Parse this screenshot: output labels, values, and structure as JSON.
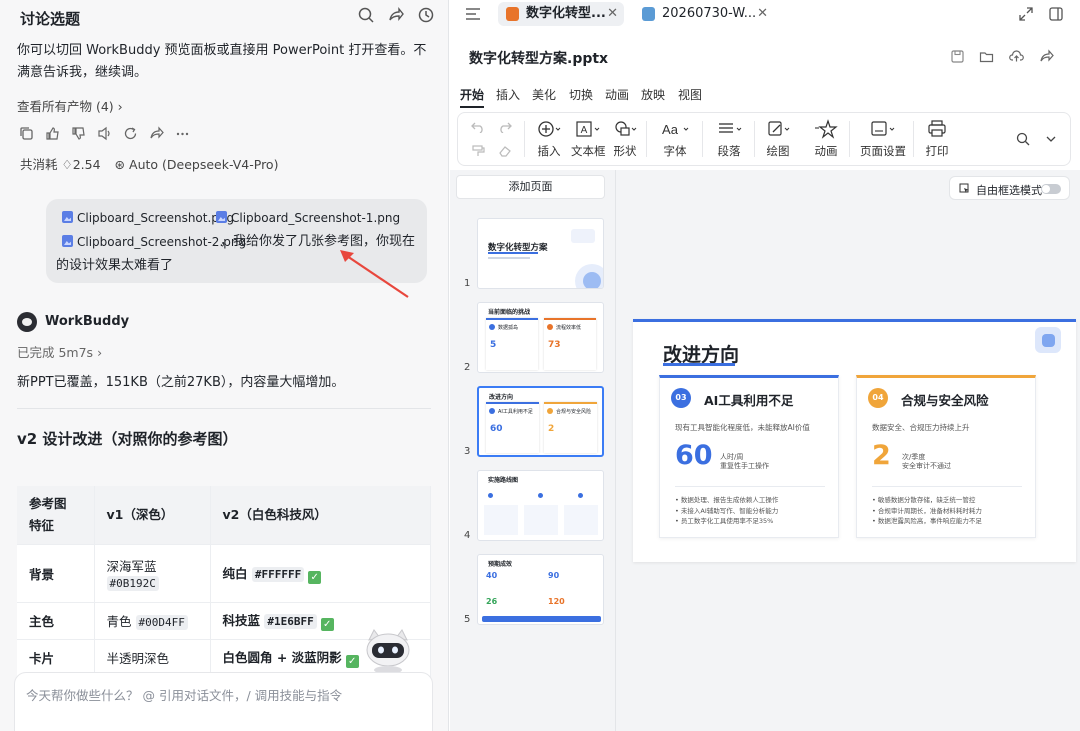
{
  "chat": {
    "title": "讨论选题",
    "intro": "你可以切回 WorkBuddy 预览面板或直接用 PowerPoint 打开查看。不满意告诉我，继续调。",
    "view_all": "查看所有产物 (4)",
    "cost_label": "共消耗",
    "cost_value": "2.54",
    "model": "Auto (Deepseek-V4-Pro)",
    "user_message": {
      "files": [
        "Clipboard_Screenshot.png",
        "Clipboard_Screenshot-1.png",
        "Clipboard_Screenshot-2.png"
      ],
      "text_part1": "，我给你发了几张参考图，你现在",
      "text_part2": "的设计效果太难看了"
    },
    "assistant": {
      "name": "WorkBuddy",
      "status": "已完成 5m7s",
      "message": "新PPT已覆盖，151KB（之前27KB），内容量大幅增加。"
    },
    "section_heading": "v2 设计改进（对照你的参考图）",
    "table": {
      "headers": [
        "参考图\n特征",
        "v1（深色）",
        "v2（白色科技风）"
      ],
      "rows": [
        {
          "feature": "背景",
          "v1_text": "深海军蓝",
          "v1_code": "#0B192C",
          "v2_text": "纯白",
          "v2_code": "#FFFFFF"
        },
        {
          "feature": "主色",
          "v1_text": "青色",
          "v1_code": "#00D4FF",
          "v2_text": "科技蓝",
          "v2_code": "#1E6BFF"
        },
        {
          "feature": "卡片",
          "v1_text": "半透明深色",
          "v1_code": "",
          "v2_text": "白色圆角 + 淡蓝阴影",
          "v2_code": ""
        }
      ]
    },
    "input_placeholder": "今天帮你做些什么？ @ 引用对话文件，/ 调用技能与指令"
  },
  "ppt": {
    "tabs": [
      {
        "label": "数字化转型...",
        "icon": "pptx-icon",
        "color": "#e8742a"
      },
      {
        "label": "20260730-W...",
        "icon": "markdown-icon",
        "color": "#5b9bd5"
      }
    ],
    "doc_title": "数字化转型方案.pptx",
    "ribbon_tabs": [
      "开始",
      "插入",
      "美化",
      "切换",
      "动画",
      "放映",
      "视图"
    ],
    "tools": [
      "插入",
      "文本框",
      "形状",
      "字体",
      "段落",
      "绘图",
      "动画",
      "页面设置",
      "打印"
    ],
    "add_page": "添加页面",
    "free_select": "自由框选模式",
    "thumbnails": [
      {
        "num": "1",
        "title": "数字化转型方案"
      },
      {
        "num": "2",
        "title": "当前面临的挑战",
        "cards": [
          {
            "t": "数据孤岛",
            "n": "5"
          },
          {
            "t": "流程效率低",
            "n": "73"
          }
        ]
      },
      {
        "num": "3",
        "title": "改进方向",
        "cards": [
          {
            "t": "AI工具利用不足",
            "n": "60"
          },
          {
            "t": "合规与安全风险",
            "n": "2"
          }
        ]
      },
      {
        "num": "4",
        "title": "实施路线图"
      },
      {
        "num": "5",
        "title": "预期成效",
        "cards": [
          {
            "t": "",
            "n": "40"
          },
          {
            "t": "",
            "n": "90"
          },
          {
            "t": "",
            "n": "26"
          },
          {
            "t": "",
            "n": "120"
          }
        ]
      }
    ],
    "slide": {
      "title": "改进方向",
      "cards": [
        {
          "badge": "03",
          "title": "AI工具利用不足",
          "subtitle": "现有工具智能化程度低，未能释放AI价值",
          "number": "60",
          "unit_line1": "人时/周",
          "unit_line2": "重复性手工操作",
          "bullets": [
            "数据处理、报告生成依赖人工操作",
            "未接入AI辅助写作、智能分析能力",
            "员工数字化工具使用率不足35%"
          ],
          "color": "#3b6fe0"
        },
        {
          "badge": "04",
          "title": "合规与安全风险",
          "subtitle": "数据安全、合规压力持续上升",
          "number": "2",
          "unit_line1": "次/季度",
          "unit_line2": "安全审计不通过",
          "bullets": [
            "敏感数据分散存储，缺乏统一管控",
            "合规审计周期长，准备材料耗时耗力",
            "数据泄露风险高，事件响应能力不足"
          ],
          "color": "#f0a53a"
        }
      ]
    }
  }
}
